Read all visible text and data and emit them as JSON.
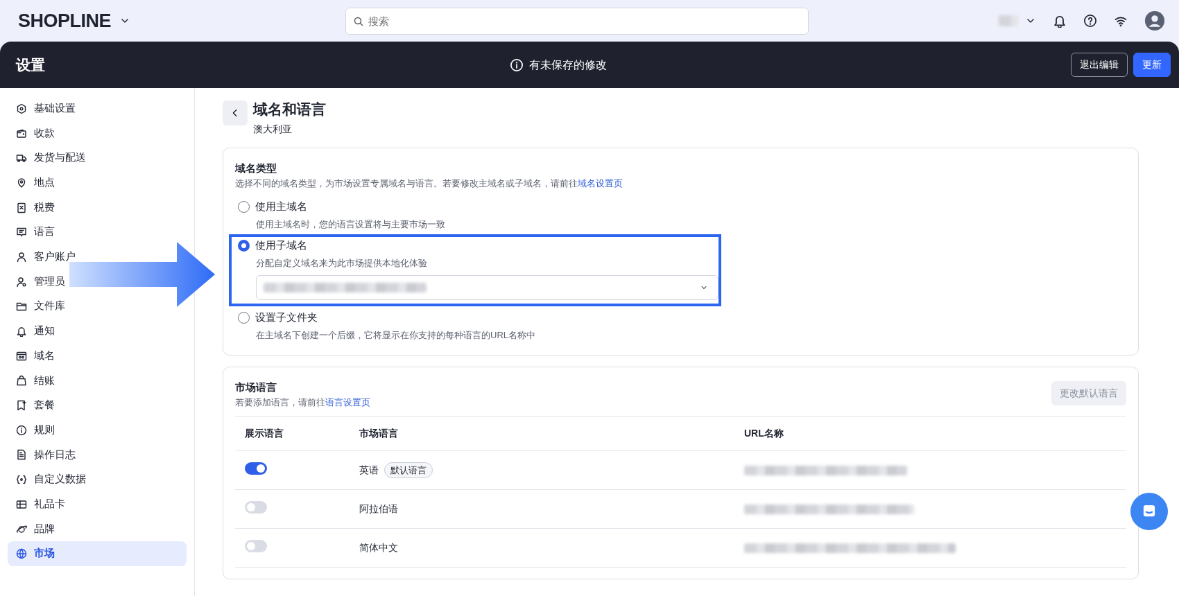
{
  "topbar": {
    "logo": "SHOPLINE",
    "search": {
      "placeholder": "搜索"
    }
  },
  "header": {
    "title": "设置",
    "notice": "有未保存的修改",
    "buttons": [
      {
        "label": "退出编辑",
        "kind": "outline"
      },
      {
        "label": "更新",
        "kind": "primary"
      }
    ]
  },
  "sidebar": {
    "items": [
      {
        "label": "基础设置",
        "selected": false
      },
      {
        "label": "收款",
        "selected": false
      },
      {
        "label": "发货与配送",
        "selected": false
      },
      {
        "label": "地点",
        "selected": false
      },
      {
        "label": "税费",
        "selected": false
      },
      {
        "label": "语言",
        "selected": false
      },
      {
        "label": "客户账户",
        "selected": false
      },
      {
        "label": "管理员",
        "selected": false
      },
      {
        "label": "文件库",
        "selected": false
      },
      {
        "label": "通知",
        "selected": false
      },
      {
        "label": "域名",
        "selected": false
      },
      {
        "label": "结账",
        "selected": false
      },
      {
        "label": "套餐",
        "selected": false
      },
      {
        "label": "规则",
        "selected": false
      },
      {
        "label": "操作日志",
        "selected": false
      },
      {
        "label": "自定义数据",
        "selected": false
      },
      {
        "label": "礼品卡",
        "selected": false
      },
      {
        "label": "品牌",
        "selected": false
      },
      {
        "label": "市场",
        "selected": true
      }
    ]
  },
  "page": {
    "title": "域名和语言",
    "subtitle": "澳大利亚"
  },
  "domain_card": {
    "title": "域名类型",
    "description": "选择不同的域名类型，为市场设置专属域名与语言。若要修改主域名或子域名，请前往",
    "link": "域名设置页",
    "options": [
      {
        "label": "使用主域名",
        "hint": "使用主域名时，您的语言设置将与主要市场一致",
        "selected": false
      },
      {
        "label": "使用子域名",
        "hint": "分配自定义域名来为此市场提供本地化体验",
        "selected": true
      },
      {
        "label": "设置子文件夹",
        "hint": "在主域名下创建一个后缀，它将显示在你支持的每种语言的URL名称中",
        "selected": false
      }
    ]
  },
  "languages_card": {
    "title": "市场语言",
    "description": "若要添加语言，请前往",
    "link": "语言设置页",
    "button": "更改默认语言",
    "columns": [
      "展示语言",
      "市场语言",
      "URL名称"
    ],
    "rows": [
      {
        "shown": true,
        "language": "英语",
        "badge": "默认语言"
      },
      {
        "shown": false,
        "language": "阿拉伯语"
      },
      {
        "shown": false,
        "language": "简体中文"
      }
    ]
  }
}
